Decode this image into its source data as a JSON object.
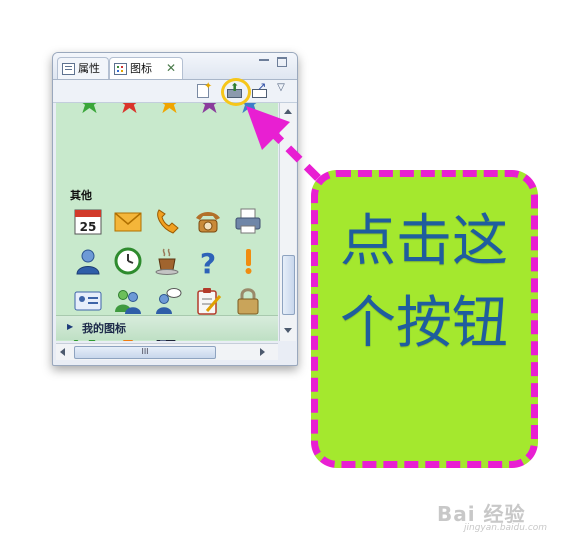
{
  "panel": {
    "tabs": [
      {
        "label": "属性",
        "icon": "properties-icon"
      },
      {
        "label": "图标",
        "icon": "icons-view-icon",
        "close": "✕"
      }
    ],
    "toolbar": {
      "buttons": [
        "new-icon",
        "export-icon",
        "import-icon",
        "view-menu-icon"
      ],
      "highlighted": "export-icon",
      "menu_glyph": "▽"
    },
    "section_title": "其他",
    "collapsed_section": "我的图标",
    "hscroll_grip": "III",
    "star_colors": [
      "#3aa63a",
      "#d9342b",
      "#f0a500",
      "#8a3c9c",
      "#3d7cc9"
    ],
    "icon_rows": [
      [
        "calendar-icon",
        "envelope-icon",
        "phone-receiver-icon",
        "telephone-icon",
        "printer-icon"
      ],
      [
        "user-icon",
        "clock-icon",
        "coffee-cup-icon",
        "question-mark-icon",
        "exclamation-icon"
      ],
      [
        "id-card-icon",
        "users-group-icon",
        "users-chat-icon",
        "clipboard-icon",
        "padlock-icon"
      ],
      [
        "checkmark-icon",
        "cross-icon",
        "bomb-icon"
      ]
    ],
    "calendar_day": "25"
  },
  "callout": {
    "text": "点击这个按钮",
    "fill": "#a4e82e",
    "border": "#e81fd2",
    "text_color": "#1f5d9e"
  },
  "watermark": {
    "text": "Bai 经验",
    "sub": "jingyan.baidu.com"
  }
}
